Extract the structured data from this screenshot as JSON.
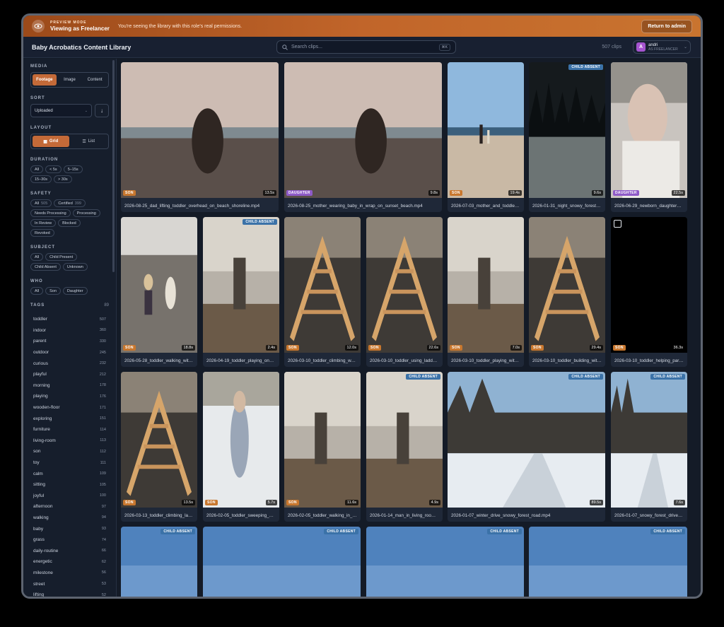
{
  "banner": {
    "kicker": "PREVIEW MODE",
    "title": "Viewing as Freelancer",
    "message": "You're seeing the library with this role's real permissions.",
    "return_label": "Return to admin"
  },
  "header": {
    "title": "Baby Acrobatics Content Library",
    "search_placeholder": "Search clips...",
    "search_shortcut": "⌘K",
    "clip_count": "507 clips",
    "user": {
      "initial": "A",
      "name": "andri",
      "role": "AS FREELANCER"
    }
  },
  "sidebar": {
    "media": {
      "label": "MEDIA",
      "options": [
        "Footage",
        "Image",
        "Content"
      ],
      "active": "Footage"
    },
    "sort": {
      "label": "SORT",
      "value": "Uploaded",
      "direction_icon": "↓"
    },
    "layout": {
      "label": "LAYOUT",
      "grid": "Grid",
      "list": "List"
    },
    "duration": {
      "label": "DURATION",
      "chips": [
        "All",
        "< 5s",
        "5–15s",
        "15–30s",
        "> 30s"
      ]
    },
    "safety": {
      "label": "SAFETY",
      "chips": [
        {
          "label": "All",
          "count": "505"
        },
        {
          "label": "Certified",
          "count": "399"
        },
        {
          "label": "Needs Processing",
          "count": ""
        },
        {
          "label": "Processing",
          "count": ""
        },
        {
          "label": "In Review",
          "count": ""
        },
        {
          "label": "Blocked",
          "count": ""
        },
        {
          "label": "Revoked",
          "count": ""
        }
      ]
    },
    "subject": {
      "label": "SUBJECT",
      "chips": [
        "All",
        "Child Present",
        "Child Absent",
        "Unknown"
      ]
    },
    "who": {
      "label": "WHO",
      "chips": [
        "All",
        "Son",
        "Daughter"
      ]
    },
    "tags": {
      "label": "TAGS",
      "count": "89",
      "items": [
        {
          "name": "toddler",
          "count": "507"
        },
        {
          "name": "indoor",
          "count": "360"
        },
        {
          "name": "parent",
          "count": "330"
        },
        {
          "name": "outdoor",
          "count": "245"
        },
        {
          "name": "curious",
          "count": "232"
        },
        {
          "name": "playful",
          "count": "212"
        },
        {
          "name": "morning",
          "count": "178"
        },
        {
          "name": "playing",
          "count": "176"
        },
        {
          "name": "wooden-floor",
          "count": "171"
        },
        {
          "name": "exploring",
          "count": "151"
        },
        {
          "name": "furniture",
          "count": "114"
        },
        {
          "name": "living-room",
          "count": "113"
        },
        {
          "name": "son",
          "count": "112"
        },
        {
          "name": "toy",
          "count": "111"
        },
        {
          "name": "calm",
          "count": "109"
        },
        {
          "name": "sitting",
          "count": "105"
        },
        {
          "name": "joyful",
          "count": "100"
        },
        {
          "name": "afternoon",
          "count": "97"
        },
        {
          "name": "walking",
          "count": "94"
        },
        {
          "name": "baby",
          "count": "93"
        },
        {
          "name": "grass",
          "count": "74"
        },
        {
          "name": "daily-routine",
          "count": "66"
        },
        {
          "name": "energetic",
          "count": "62"
        },
        {
          "name": "milestone",
          "count": "56"
        },
        {
          "name": "street",
          "count": "53"
        },
        {
          "name": "lifting",
          "count": "52"
        }
      ]
    }
  },
  "clips": [
    {
      "caption": "2026-08-25_dad_lifting_toddler_overhead_on_beach_shoreline.mp4",
      "who": "SON",
      "duration": "13.5s",
      "absent": "",
      "scene": "beach-dusk"
    },
    {
      "caption": "2026-08-25_mother_wearing_baby_in_wrap_on_sunset_beach.mp4",
      "who": "DAUGHTER",
      "duration": "9.8s",
      "absent": "",
      "scene": "beach-dusk"
    },
    {
      "caption": "2026-07-03_mother_and_toddler_walking_on_beach.mp4",
      "who": "SON",
      "duration": "19.4s",
      "absent": "",
      "scene": "beach-day"
    },
    {
      "caption": "2026-01-31_night_snowy_forest_walk.mp4",
      "who": "",
      "duration": "9.6s",
      "absent": "CHILD ABSENT",
      "scene": "night-snow"
    },
    {
      "caption": "2026-06-29_newborn_daughter_resting.mp4",
      "who": "DAUGHTER",
      "duration": "22.5s",
      "absent": "",
      "scene": "baby"
    },
    {
      "caption": "2026-05-28_toddler_walking_with_dog.mp4",
      "who": "SON",
      "duration": "18.8s",
      "absent": "",
      "scene": "patio"
    },
    {
      "caption": "2026-04-19_toddler_playing_on_climbing_frame.mp4",
      "who": "",
      "duration": "2.4s",
      "absent": "CHILD ABSENT",
      "scene": "room"
    },
    {
      "caption": "2026-03-10_toddler_climbing_wooden_triangle.mp4",
      "who": "SON",
      "duration": "12.0s",
      "absent": "",
      "scene": "wood"
    },
    {
      "caption": "2026-03-10_toddler_using_ladder.mp4",
      "who": "SON",
      "duration": "22.6s",
      "absent": "",
      "scene": "wood"
    },
    {
      "caption": "2026-03-10_toddler_playing_with_parent.mp4",
      "who": "SON",
      "duration": "7.0s",
      "absent": "",
      "scene": "room"
    },
    {
      "caption": "2026-03-10_toddler_building_with_blocks.mp4",
      "who": "SON",
      "duration": "29.4s",
      "absent": "",
      "scene": "wood"
    },
    {
      "caption": "2026-03-10_toddler_helping_parent.mp4",
      "who": "SON",
      "duration": "36.3s",
      "absent": "",
      "scene": "black"
    },
    {
      "caption": "2026-03-13_toddler_climbing_ladder.mp4",
      "who": "SON",
      "duration": "13.5s",
      "absent": "",
      "scene": "wood"
    },
    {
      "caption": "2026-02-05_toddler_sweeping_snow.mp4",
      "who": "SON",
      "duration": "5.7s",
      "absent": "",
      "scene": "snow"
    },
    {
      "caption": "2026-02-05_toddler_walking_in_room.mp4",
      "who": "SON",
      "duration": "11.6s",
      "absent": "",
      "scene": "room"
    },
    {
      "caption": "2026-01-14_man_in_living_room.mp4",
      "who": "",
      "duration": "4.9s",
      "absent": "CHILD ABSENT",
      "scene": "room"
    },
    {
      "caption": "2026-01-07_winter_drive_snowy_forest_road.mp4",
      "who": "",
      "duration": "89.5s",
      "absent": "CHILD ABSENT",
      "scene": "snow-road"
    },
    {
      "caption": "2026-01-07_snowy_forest_drive.mp4",
      "who": "",
      "duration": "7.6s",
      "absent": "CHILD ABSENT",
      "scene": "snow-road"
    },
    {
      "caption": "",
      "who": "",
      "duration": "",
      "absent": "CHILD ABSENT",
      "scene": "sky"
    },
    {
      "caption": "",
      "who": "",
      "duration": "",
      "absent": "CHILD ABSENT",
      "scene": "sky"
    },
    {
      "caption": "",
      "who": "",
      "duration": "",
      "absent": "CHILD ABSENT",
      "scene": "sky"
    },
    {
      "caption": "",
      "who": "",
      "duration": "",
      "absent": "CHILD ABSENT",
      "scene": "sky"
    }
  ]
}
